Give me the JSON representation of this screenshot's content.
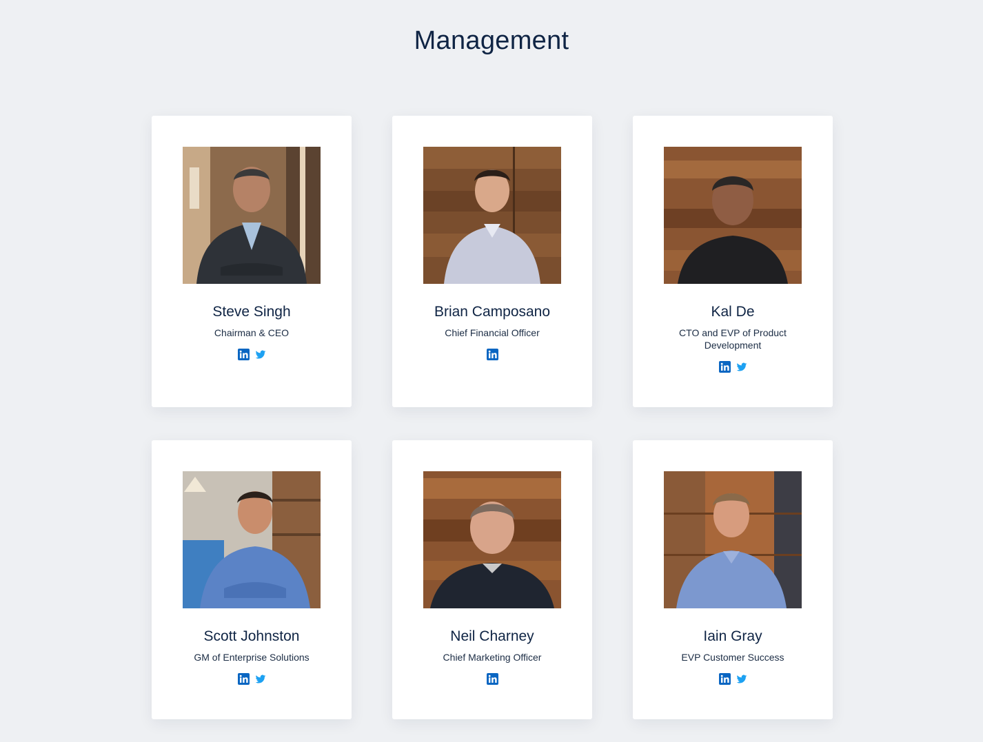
{
  "page": {
    "title": "Management"
  },
  "colors": {
    "background": "#eef0f3",
    "card": "#ffffff",
    "heading": "#0f2444",
    "linkedin": "#0a66c2",
    "twitter": "#1da1f2"
  },
  "team": [
    {
      "name": "Steve Singh",
      "title": "Chairman & CEO",
      "socials": [
        "linkedin-icon",
        "twitter-icon"
      ]
    },
    {
      "name": "Brian Camposano",
      "title": "Chief Financial Officer",
      "socials": [
        "linkedin-icon"
      ]
    },
    {
      "name": "Kal De",
      "title": "CTO and EVP of Product Development",
      "socials": [
        "linkedin-icon",
        "twitter-icon"
      ]
    },
    {
      "name": "Scott Johnston",
      "title": "GM of Enterprise Solutions",
      "socials": [
        "linkedin-icon",
        "twitter-icon"
      ]
    },
    {
      "name": "Neil Charney",
      "title": "Chief Marketing Officer",
      "socials": [
        "linkedin-icon"
      ]
    },
    {
      "name": "Iain Gray",
      "title": "EVP Customer Success",
      "socials": [
        "linkedin-icon",
        "twitter-icon"
      ]
    }
  ]
}
